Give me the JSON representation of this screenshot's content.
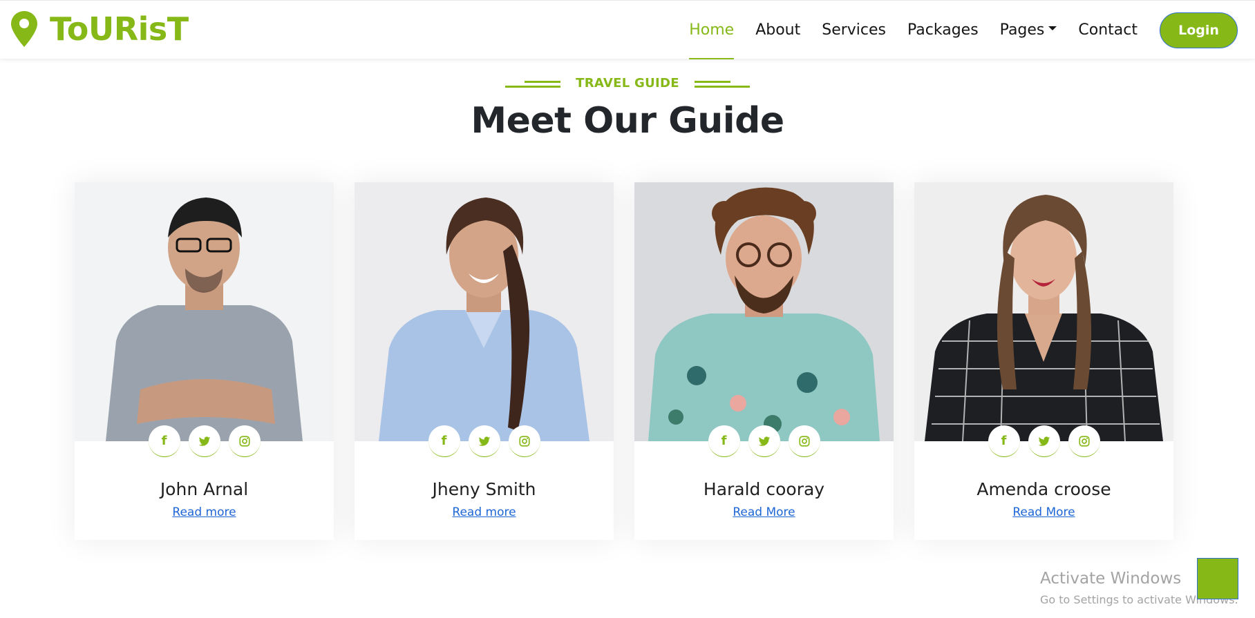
{
  "brand": {
    "name": "ToURisT",
    "icon": "map-pin-icon",
    "accent_color": "#86b817"
  },
  "nav": {
    "items": [
      {
        "label": "Home",
        "active": true
      },
      {
        "label": "About",
        "active": false
      },
      {
        "label": "Services",
        "active": false
      },
      {
        "label": "Packages",
        "active": false
      },
      {
        "label": "Pages",
        "active": false,
        "dropdown": true
      },
      {
        "label": "Contact",
        "active": false
      }
    ],
    "login_label": "Login"
  },
  "section": {
    "eyebrow": "TRAVEL GUIDE",
    "title": "Meet Our Guide"
  },
  "guides": [
    {
      "name": "John Arnal",
      "link": "Read more",
      "socials": [
        "facebook-icon",
        "twitter-icon",
        "instagram-icon"
      ]
    },
    {
      "name": "Jheny Smith",
      "link": "Read more",
      "socials": [
        "facebook-icon",
        "twitter-icon",
        "instagram-icon"
      ]
    },
    {
      "name": "Harald cooray",
      "link": "Read More",
      "socials": [
        "facebook-icon",
        "twitter-icon",
        "instagram-icon"
      ]
    },
    {
      "name": "Amenda croose",
      "link": "Read More",
      "socials": [
        "facebook-icon",
        "twitter-icon",
        "instagram-icon"
      ]
    }
  ],
  "watermark": {
    "title": "Activate Windows",
    "subtitle": "Go to Settings to activate Windows."
  }
}
